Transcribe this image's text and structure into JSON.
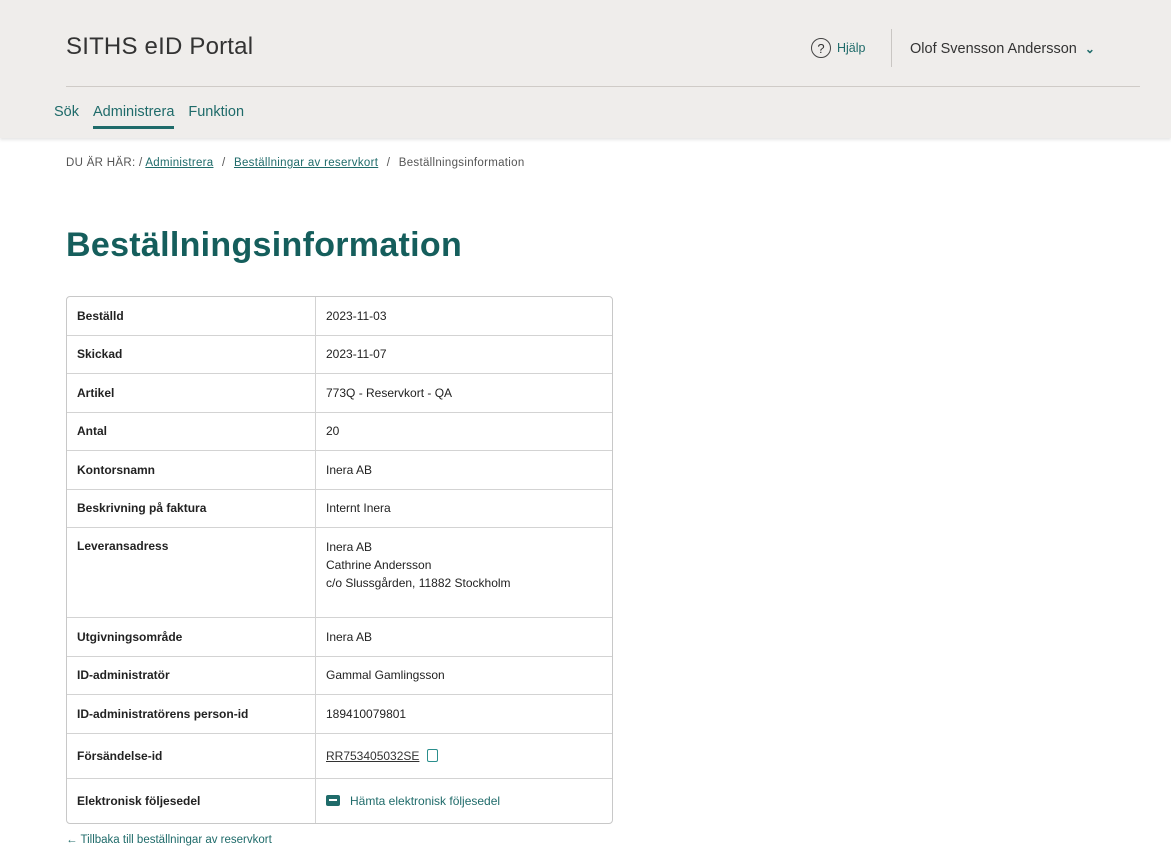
{
  "header": {
    "app_title": "SITHS eID Portal",
    "help_icon_glyph": "?",
    "help_label": "Hjälp",
    "user_name": "Olof Svensson Andersson",
    "user_chevron": "⌄"
  },
  "nav": {
    "tabs": [
      {
        "label": "Sök",
        "active": false
      },
      {
        "label": "Administrera",
        "active": true
      },
      {
        "label": "Funktion",
        "active": false
      }
    ]
  },
  "breadcrumb": {
    "prefix": "DU ÄR HÄR: /",
    "items": [
      "Administrera",
      "Beställningar av reservkort"
    ],
    "current": "Beställningsinformation",
    "separator": "/"
  },
  "page": {
    "title": "Beställningsinformation"
  },
  "details": {
    "rows": [
      {
        "label": "Beställd",
        "value": "2023-11-03"
      },
      {
        "label": "Skickad",
        "value": "2023-11-07"
      },
      {
        "label": "Artikel",
        "value": "773Q - Reservkort - QA"
      },
      {
        "label": "Antal",
        "value": "20"
      },
      {
        "label": "Kontorsnamn",
        "value": "Inera AB"
      },
      {
        "label": "Beskrivning på faktura",
        "value": "Internt Inera"
      },
      {
        "label": "Leveransadress",
        "lines": [
          "Inera AB",
          "Cathrine Andersson",
          "c/o Slussgården, 11882 Stockholm"
        ]
      },
      {
        "label": "Utgivningsområde",
        "value": "Inera AB"
      },
      {
        "label": "ID-administratör",
        "value": "Gammal Gamlingsson"
      },
      {
        "label": "ID-administratörens person-id",
        "value": "189410079801"
      },
      {
        "label": "Försändelse-id",
        "value": "RR753405032SE"
      },
      {
        "label": "Elektronisk följesedel",
        "link": "Hämta elektronisk följesedel"
      }
    ]
  },
  "footer": {
    "back_link": "← Tillbaka till beställningar av reservkort"
  },
  "colors": {
    "accent": "#1f6b6a",
    "heading": "#155e5c",
    "topbar_bg": "#efedeb"
  }
}
